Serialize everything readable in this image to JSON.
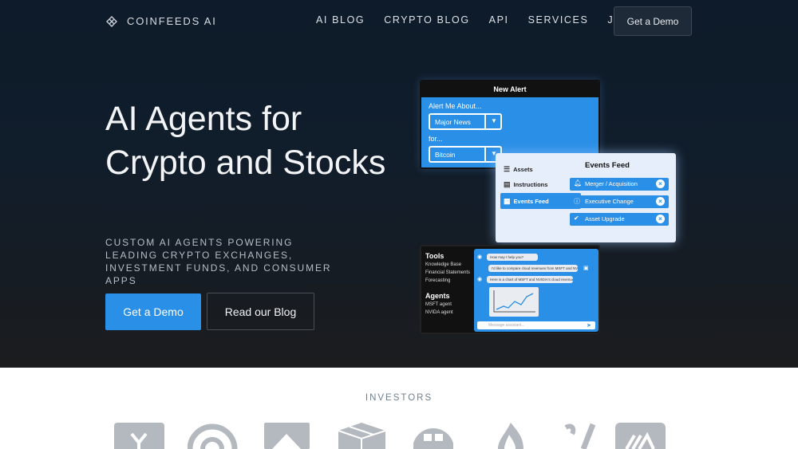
{
  "brand": {
    "name": "COINFEEDS AI"
  },
  "nav": {
    "links": [
      "AI BLOG",
      "CRYPTO BLOG",
      "API",
      "SERVICES",
      "JOBS"
    ],
    "cta": "Get a Demo"
  },
  "hero": {
    "headline": "AI Agents for Crypto and Stocks",
    "subheadline": "CUSTOM AI AGENTS POWERING LEADING CRYPTO EXCHANGES, INVESTMENT FUNDS, AND CONSUMER APPS",
    "primary_button": "Get a Demo",
    "secondary_button": "Read our Blog"
  },
  "illustration": {
    "alert_card": {
      "title": "New Alert",
      "alert_label": "Alert Me About...",
      "alert_value": "Major News",
      "for_label": "for...",
      "for_value": "Bitcoin"
    },
    "events_card": {
      "sidebar": [
        "Assets",
        "Instructions",
        "Events Feed"
      ],
      "title": "Events Feed",
      "items": [
        "Merger / Acquisition",
        "Executive Change",
        "Asset Upgrade"
      ]
    },
    "chat_card": {
      "tools_heading": "Tools",
      "tools": [
        "Knowledge Base",
        "Financial Statements",
        "Forecasting"
      ],
      "agents_heading": "Agents",
      "agents": [
        "MSFT agent",
        "NVIDA agent"
      ],
      "messages": [
        "How may I help you?",
        "I'd like to compare cloud revenues from MSFT and NVIDIA",
        "Here is a chart of MSFT and NVIDIA's cloud revenues..."
      ],
      "input_placeholder": "Message assistant..."
    }
  },
  "investors": {
    "heading": "INVESTORS"
  },
  "colors": {
    "accent": "#2a8fe6",
    "hero_bg": "#101d2b",
    "logo_gray": "#b4b9bf"
  },
  "icons": [
    "coinfeeds-logo-icon",
    "database-icon",
    "clipboard-icon",
    "calendar-icon",
    "bell-icon",
    "info-icon",
    "check-icon",
    "close-icon",
    "eye-icon",
    "robot-icon",
    "send-icon"
  ]
}
